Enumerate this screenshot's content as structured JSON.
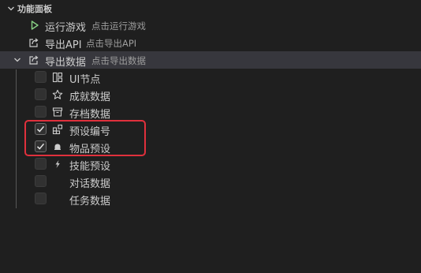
{
  "panel": {
    "title": "功能面板"
  },
  "commands": [
    {
      "label": "运行游戏",
      "description": "点击运行游戏",
      "icon": "play-icon"
    },
    {
      "label": "导出API",
      "description": "点击导出API",
      "icon": "export-icon"
    },
    {
      "label": "导出数据",
      "description": "点击导出数据",
      "icon": "export-icon"
    }
  ],
  "data_items": [
    {
      "label": "UI节点",
      "checked": false,
      "icon": "layout-icon"
    },
    {
      "label": "成就数据",
      "checked": false,
      "icon": "star-icon"
    },
    {
      "label": "存档数据",
      "checked": false,
      "icon": "archive-icon"
    },
    {
      "label": "预设编号",
      "checked": true,
      "icon": "extensions-icon"
    },
    {
      "label": "物品预设",
      "checked": true,
      "icon": "item-icon"
    },
    {
      "label": "技能预设",
      "checked": false,
      "icon": "lightning-icon"
    },
    {
      "label": "对话数据",
      "checked": false,
      "icon": ""
    },
    {
      "label": "任务数据",
      "checked": false,
      "icon": ""
    }
  ],
  "colors": {
    "background": "#1f1f1f",
    "selected_row": "#37373d",
    "play_green": "#89d185",
    "highlight_red": "#e0303c"
  }
}
